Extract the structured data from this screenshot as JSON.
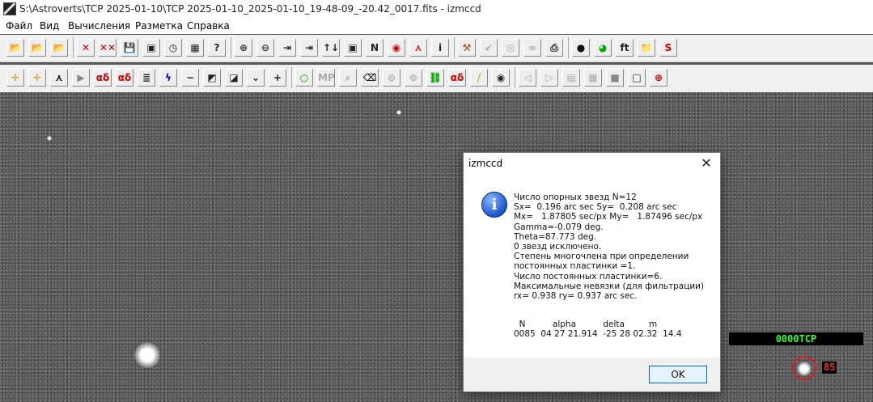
{
  "window": {
    "title": "S:\\Astroverts\\TCP 2025-01-10\\TCP 2025-01-10_2025-01-10_19-48-09_-20.42_0017.fits - izmccd"
  },
  "menu": {
    "items": [
      "Файл",
      "Вид",
      "Вычисления",
      "Разметка",
      "Справка"
    ]
  },
  "toolbar1": {
    "buttons": [
      {
        "name": "open-icon",
        "glyph": "📂"
      },
      {
        "name": "open-list-icon",
        "glyph": "📂"
      },
      {
        "name": "open-series-icon",
        "glyph": "📂"
      },
      {
        "name": "delete-icon",
        "glyph": "✕"
      },
      {
        "name": "delete-all-icon",
        "glyph": "✕✕"
      },
      {
        "name": "save-icon",
        "glyph": "💾"
      },
      {
        "name": "copy-icon",
        "glyph": "▣"
      },
      {
        "name": "clock-icon",
        "glyph": "◷"
      },
      {
        "name": "palette-icon",
        "glyph": "▦"
      },
      {
        "name": "help-icon",
        "glyph": "?"
      },
      {
        "name": "zoom-in-icon",
        "glyph": "⊕"
      },
      {
        "name": "zoom-out-icon",
        "glyph": "⊖"
      },
      {
        "name": "arrow-right-icon",
        "glyph": "⇥"
      },
      {
        "name": "arrow-right-gray-icon",
        "glyph": "⇥"
      },
      {
        "name": "flip-vertical-icon",
        "glyph": "↑↓"
      },
      {
        "name": "frame-icon",
        "glyph": "▣"
      },
      {
        "name": "north-icon",
        "glyph": "N"
      },
      {
        "name": "target-color-icon",
        "glyph": "◉"
      },
      {
        "name": "axes-icon",
        "glyph": "⋏"
      },
      {
        "name": "info-i-icon",
        "glyph": "i"
      },
      {
        "name": "hammer-icon",
        "glyph": "⚒"
      },
      {
        "name": "arrow-back-icon",
        "glyph": "↙"
      },
      {
        "name": "eye-icon",
        "glyph": "◎"
      },
      {
        "name": "infinity-icon",
        "glyph": "∞"
      },
      {
        "name": "print-icon",
        "glyph": "⎙"
      },
      {
        "name": "dots-circle-icon",
        "glyph": "●"
      },
      {
        "name": "color-wheel-icon",
        "glyph": "◕"
      },
      {
        "name": "ft-icon",
        "glyph": "ft"
      },
      {
        "name": "folder-icon",
        "glyph": "📁"
      },
      {
        "name": "rgb-icon",
        "glyph": "S"
      }
    ]
  },
  "toolbar2": {
    "buttons": [
      {
        "name": "crosshair-icon",
        "glyph": "✛"
      },
      {
        "name": "crosshair-yellow-icon",
        "glyph": "✛"
      },
      {
        "name": "split-icon",
        "glyph": "⋏"
      },
      {
        "name": "play-icon",
        "glyph": "▶"
      },
      {
        "name": "alpha-delta-icon",
        "glyph": "αδ"
      },
      {
        "name": "alpha-delta-box-icon",
        "glyph": "αδ"
      },
      {
        "name": "list-icon",
        "glyph": "≣"
      },
      {
        "name": "lightning-icon",
        "glyph": "ϟ"
      },
      {
        "name": "minus-icon",
        "glyph": "−"
      },
      {
        "name": "contrast-icon",
        "glyph": "◩"
      },
      {
        "name": "stretch-icon",
        "glyph": "◪"
      },
      {
        "name": "merge-icon",
        "glyph": "⌄"
      },
      {
        "name": "plus-icon",
        "glyph": "+"
      },
      {
        "name": "circle-icon",
        "glyph": "○"
      },
      {
        "name": "mp-icon",
        "glyph": "MP"
      },
      {
        "name": "search-gray-icon",
        "glyph": "⌕"
      },
      {
        "name": "eraser-icon",
        "glyph": "⌫"
      },
      {
        "name": "nav-forward-icon",
        "glyph": "⊙"
      },
      {
        "name": "nav-back-icon",
        "glyph": "⊙"
      },
      {
        "name": "link-icon",
        "glyph": "⛓"
      },
      {
        "name": "alpha-delta-circle-icon",
        "glyph": "αδ"
      },
      {
        "name": "ruler-icon",
        "glyph": "⧸"
      },
      {
        "name": "ring-icon",
        "glyph": "◉"
      },
      {
        "name": "prev-frame-icon",
        "glyph": "◁"
      },
      {
        "name": "next-frame-icon",
        "glyph": "▷"
      },
      {
        "name": "stack-icon",
        "glyph": "▤"
      },
      {
        "name": "layers-icon",
        "glyph": "▦"
      },
      {
        "name": "square-gray-icon",
        "glyph": "■"
      },
      {
        "name": "square-outline-icon",
        "glyph": "□"
      },
      {
        "name": "crosshair-red-icon",
        "glyph": "⊕"
      }
    ]
  },
  "image": {
    "object_label": "0000TCP",
    "star_number": "85"
  },
  "dialog": {
    "title": "izmccd",
    "close_glyph": "✕",
    "icon_glyph": "i",
    "message": "Число опорных звезд N=12\nSx=  0.196 arc sec Sy=  0.208 arc sec\nMx=   1.87805 sec/px My=   1.87496 sec/px\nGamma=-0.079 deg.\nTheta=87.773 deg.\n0 звезд исключено.\nСтепень многочлена при определении\nпостоянных пластинки =1.\nЧисло постоянных пластинки=6.\nМаксимальные невязки (для фильтрации)\nrx= 0.938 ry= 0.937 arc sec.",
    "table_header": "  N          alpha          delta         m",
    "table_row": "0085  04 27 21.914  -25 28 02.32  14.4",
    "ok_label": "OK"
  }
}
